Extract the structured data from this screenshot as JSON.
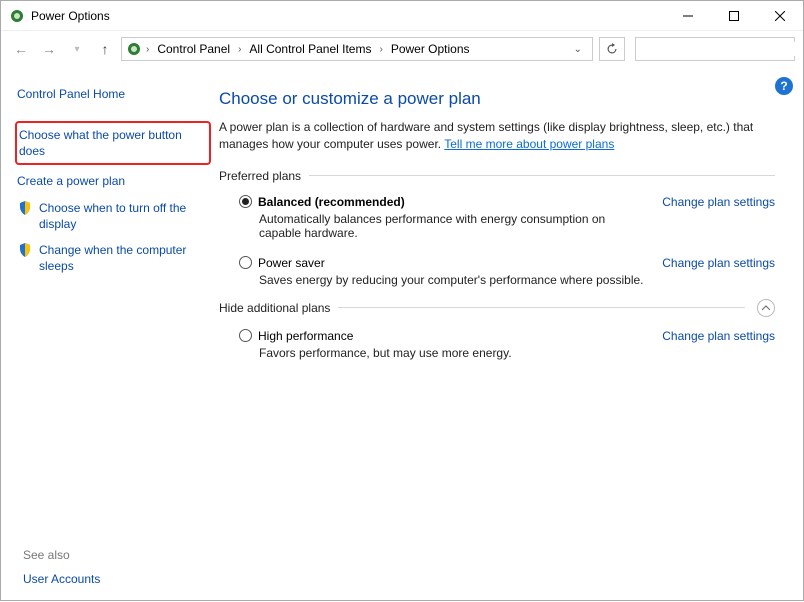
{
  "titlebar": {
    "title": "Power Options"
  },
  "breadcrumbs": {
    "home": "Control Panel",
    "mid": "All Control Panel Items",
    "leaf": "Power Options"
  },
  "search": {
    "placeholder": ""
  },
  "sidebar": {
    "home": "Control Panel Home",
    "items": [
      {
        "label": "Choose what the power button does"
      },
      {
        "label": "Create a power plan"
      },
      {
        "label": "Choose when to turn off the display"
      },
      {
        "label": "Change when the computer sleeps"
      }
    ],
    "see_also_title": "See also",
    "see_also_link": "User Accounts"
  },
  "main": {
    "title": "Choose or customize a power plan",
    "description_pre": "A power plan is a collection of hardware and system settings (like display brightness, sleep, etc.) that manages how your computer uses power. ",
    "description_link": "Tell me more about power plans",
    "preferred_label": "Preferred plans",
    "hide_label": "Hide additional plans",
    "change_settings_label": "Change plan settings",
    "plans_preferred": [
      {
        "name": "Balanced (recommended)",
        "desc": "Automatically balances performance with energy consumption on capable hardware.",
        "checked": true
      },
      {
        "name": "Power saver",
        "desc": "Saves energy by reducing your computer's performance where possible.",
        "checked": false
      }
    ],
    "plans_additional": [
      {
        "name": "High performance",
        "desc": "Favors performance, but may use more energy.",
        "checked": false
      }
    ]
  }
}
